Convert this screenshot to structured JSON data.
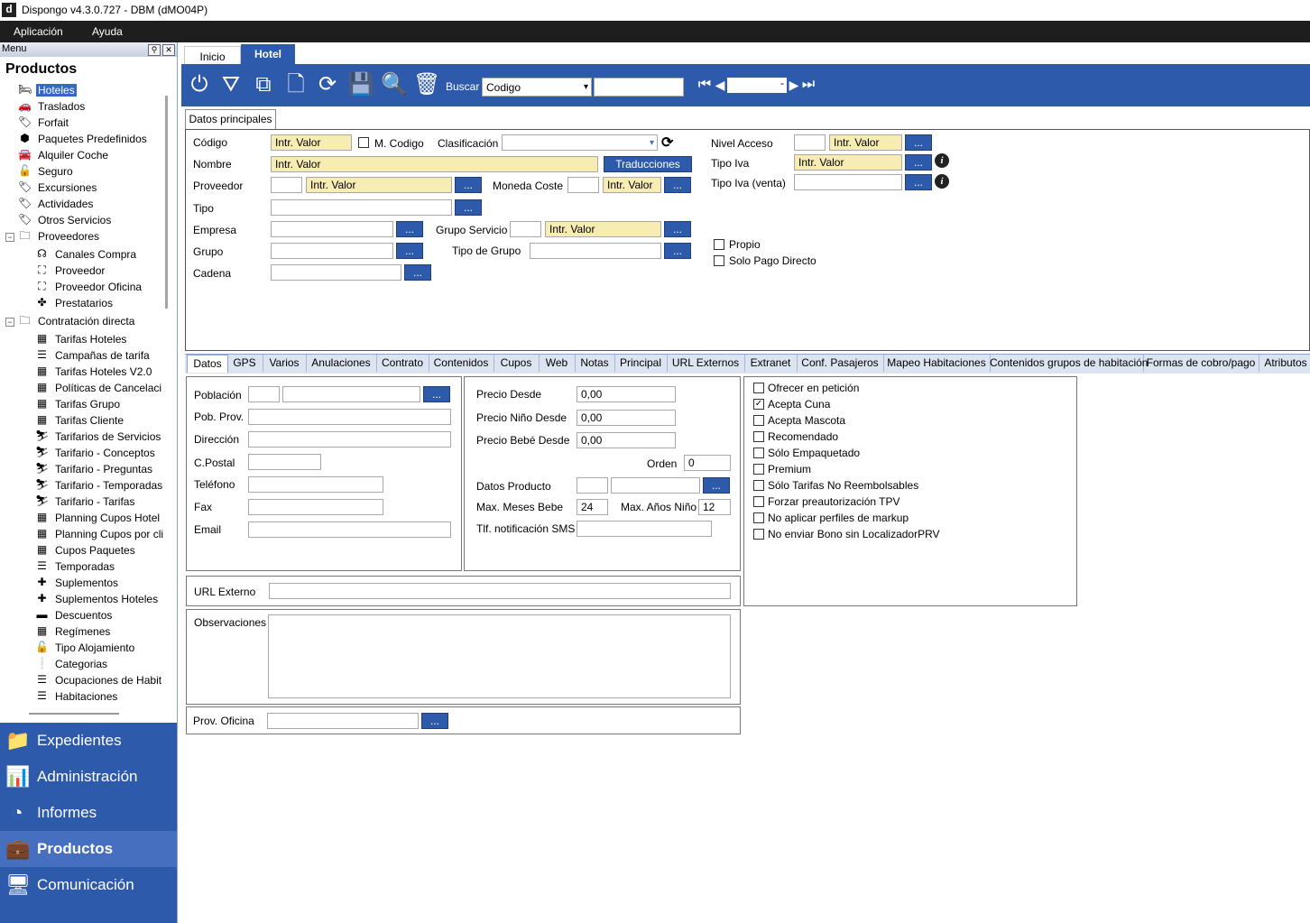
{
  "app": {
    "title": "Dispongo v4.3.0.727 - DBM (dMO04P)",
    "logo_letter": "d"
  },
  "menubar": {
    "items": [
      "Aplicación",
      "Ayuda"
    ]
  },
  "sidebar": {
    "menu_label": "Menu",
    "pin": "⚲",
    "close": "✕",
    "section_title": "Productos",
    "tree": [
      {
        "label": "Hoteles",
        "icon": "bed-icon",
        "glyph": "🛏",
        "level": 0,
        "selected": true
      },
      {
        "label": "Traslados",
        "icon": "car-icon",
        "glyph": "🚗",
        "level": 0
      },
      {
        "label": "Forfait",
        "icon": "tag-icon",
        "glyph": "🏷",
        "level": 0
      },
      {
        "label": "Paquetes Predefinidos",
        "icon": "cube-icon",
        "glyph": "⬢",
        "level": 0
      },
      {
        "label": "Alquiler Coche",
        "icon": "car-icon",
        "glyph": "🚘",
        "level": 0
      },
      {
        "label": "Seguro",
        "icon": "lock-icon",
        "glyph": "🔓",
        "level": 0
      },
      {
        "label": "Excursiones",
        "icon": "tag-icon",
        "glyph": "🏷",
        "level": 0
      },
      {
        "label": "Actividades",
        "icon": "tag-icon",
        "glyph": "🏷",
        "level": 0
      },
      {
        "label": "Otros Servicios",
        "icon": "tag-icon",
        "glyph": "🏷",
        "level": 0
      },
      {
        "label": "Proveedores",
        "icon": "folder-icon",
        "glyph": "🗀",
        "level": 0,
        "expander": "−"
      },
      {
        "label": "Canales Compra",
        "icon": "signal-icon",
        "glyph": "☊",
        "level": 1
      },
      {
        "label": "Proveedor",
        "icon": "sitemap-icon",
        "glyph": "⛶",
        "level": 1
      },
      {
        "label": "Proveedor Oficina",
        "icon": "sitemap-icon",
        "glyph": "⛶",
        "level": 1
      },
      {
        "label": "Prestatarios",
        "icon": "puzzle-icon",
        "glyph": "✤",
        "level": 1
      },
      {
        "label": "Contratación directa",
        "icon": "folder-icon",
        "glyph": "🗀",
        "level": 0,
        "expander": "−"
      },
      {
        "label": "Tarifas Hoteles",
        "icon": "calendar-icon",
        "glyph": "▦",
        "level": 1
      },
      {
        "label": "Campañas de tarifa",
        "icon": "list-icon",
        "glyph": "☰",
        "level": 1
      },
      {
        "label": "Tarifas Hoteles V2.0",
        "icon": "calendar-icon",
        "glyph": "▦",
        "level": 1
      },
      {
        "label": "Políticas de Cancelaci",
        "icon": "calendar-icon",
        "glyph": "▦",
        "level": 1
      },
      {
        "label": "Tarifas Grupo",
        "icon": "calendar-icon",
        "glyph": "▦",
        "level": 1
      },
      {
        "label": "Tarifas Cliente",
        "icon": "calendar-icon",
        "glyph": "▦",
        "level": 1
      },
      {
        "label": "Tarifarios de Servicios",
        "icon": "skier-icon",
        "glyph": "⛷",
        "level": 1
      },
      {
        "label": "Tarifario - Conceptos",
        "icon": "skier-icon",
        "glyph": "⛷",
        "level": 1
      },
      {
        "label": "Tarifario - Preguntas",
        "icon": "skier-icon",
        "glyph": "⛷",
        "level": 1
      },
      {
        "label": "Tarifario - Temporadas",
        "icon": "skier-icon",
        "glyph": "⛷",
        "level": 1
      },
      {
        "label": "Tarifario - Tarifas",
        "icon": "skier-icon",
        "glyph": "⛷",
        "level": 1
      },
      {
        "label": "Planning Cupos Hotel",
        "icon": "calendar-icon",
        "glyph": "▦",
        "level": 1
      },
      {
        "label": "Planning Cupos por cli",
        "icon": "calendar-icon",
        "glyph": "▦",
        "level": 1
      },
      {
        "label": "Cupos Paquetes",
        "icon": "calendar-icon",
        "glyph": "▦",
        "level": 1
      },
      {
        "label": "Temporadas",
        "icon": "list-icon",
        "glyph": "☰",
        "level": 1
      },
      {
        "label": "Suplementos",
        "icon": "plus-icon",
        "glyph": "✚",
        "level": 1
      },
      {
        "label": "Suplementos Hoteles",
        "icon": "plus-icon",
        "glyph": "✚",
        "level": 1
      },
      {
        "label": "Descuentos",
        "icon": "minus-icon",
        "glyph": "▬",
        "level": 1
      },
      {
        "label": "Regímenes",
        "icon": "calendar-icon",
        "glyph": "▦",
        "level": 1
      },
      {
        "label": "Tipo Alojamiento",
        "icon": "lock-icon",
        "glyph": "🔓",
        "level": 1
      },
      {
        "label": "Categorias",
        "icon": "exclamation-icon",
        "glyph": "❕",
        "level": 1
      },
      {
        "label": "Ocupaciones de Habit",
        "icon": "list-icon",
        "glyph": "☰",
        "level": 1
      },
      {
        "label": "Habitaciones",
        "icon": "list-icon",
        "glyph": "☰",
        "level": 1
      }
    ],
    "nav": [
      {
        "label": "Expedientes",
        "icon": "folder-icon",
        "glyph": "📁"
      },
      {
        "label": "Administración",
        "icon": "bar-chart-icon",
        "glyph": "📊"
      },
      {
        "label": "Informes",
        "icon": "pie-chart-icon",
        "glyph": "◔"
      },
      {
        "label": "Productos",
        "icon": "suitcase-icon",
        "glyph": "💼",
        "active": true
      },
      {
        "label": "Comunicación",
        "icon": "monitor-icon",
        "glyph": "🖥"
      }
    ]
  },
  "tabs": {
    "inicio": "Inicio",
    "hotel": "Hotel"
  },
  "toolbar": {
    "buscar_label": "Buscar",
    "search_field_value": "Codigo",
    "search_text": "",
    "nav_value": "",
    "dropdown_arrow": "▾",
    "icons": {
      "power": "⏻",
      "filter": "⛛",
      "copy": "⧉",
      "new": "🗋",
      "refresh": "⟳",
      "save": "💾",
      "search": "🔍",
      "delete": "🗑",
      "first": "⏮",
      "prev": "◀",
      "next": "▶",
      "last": "⏭",
      "minus": "-"
    }
  },
  "main_tab": "Datos principales",
  "form": {
    "codigo": "Código",
    "codigo_val": "Intr. Valor",
    "m_codigo": "M. Codigo",
    "clasificacion": "Clasificación",
    "nombre": "Nombre",
    "nombre_val": "Intr. Valor",
    "traducciones": "Traducciones",
    "proveedor": "Proveedor",
    "proveedor_val": "Intr. Valor",
    "moneda_coste": "Moneda Coste",
    "moneda_val": "Intr. Valor",
    "tipo": "Tipo",
    "empresa": "Empresa",
    "grupo_servicio": "Grupo Servicio",
    "grupo_servicio_val": "Intr. Valor",
    "grupo": "Grupo",
    "tipo_de_grupo": "Tipo de Grupo",
    "cadena": "Cadena",
    "nivel_acceso": "Nivel Acceso",
    "nivel_val": "Intr. Valor",
    "tipo_iva": "Tipo Iva",
    "tipo_iva_val": "Intr. Valor",
    "tipo_iva_venta": "Tipo Iva (venta)",
    "propio": "Propio",
    "solo_pago": "Solo Pago Directo",
    "ellipsis": "...",
    "info": "i",
    "refresh": "⟳"
  },
  "subtabs": [
    {
      "label": "Datos",
      "w": 44
    },
    {
      "label": "GPS",
      "w": 40
    },
    {
      "label": "Varios",
      "w": 48
    },
    {
      "label": "Anulaciones",
      "w": 78
    },
    {
      "label": "Contrato",
      "w": 58
    },
    {
      "label": "Contenidos",
      "w": 72
    },
    {
      "label": "Cupos",
      "w": 50
    },
    {
      "label": "Web",
      "w": 40
    },
    {
      "label": "Notas",
      "w": 44
    },
    {
      "label": "Principal",
      "w": 58
    },
    {
      "label": "URL Externos",
      "w": 86
    },
    {
      "label": "Extranet",
      "w": 58
    },
    {
      "label": "Conf. Pasajeros",
      "w": 96
    },
    {
      "label": "Mapeo Habitaciones",
      "w": 118
    },
    {
      "label": "Contenidos grupos de habitación",
      "w": 170
    },
    {
      "label": "Formas de cobro/pago",
      "w": 128
    },
    {
      "label": "Atributos",
      "w": 60
    }
  ],
  "datos": {
    "poblacion": "Población",
    "pob_prov": "Pob. Prov.",
    "direccion": "Dirección",
    "cpostal": "C.Postal",
    "telefono": "Teléfono",
    "fax": "Fax",
    "email": "Email",
    "precio_desde": "Precio Desde",
    "precio_desde_val": "0,00",
    "precio_nino": "Precio Niño Desde",
    "precio_nino_val": "0,00",
    "precio_bebe": "Precio Bebé Desde",
    "precio_bebe_val": "0,00",
    "orden": "Orden",
    "orden_val": "0",
    "datos_producto": "Datos Producto",
    "max_meses_bebe": "Max. Meses Bebe",
    "max_meses_val": "24",
    "max_anos_nino": "Max. Años Niño",
    "max_anos_val": "12",
    "tlf_sms": "Tlf. notificación SMS",
    "url_externo": "URL Externo",
    "observaciones": "Observaciones",
    "prov_oficina": "Prov. Oficina"
  },
  "checks": [
    {
      "label": "Ofrecer en petición",
      "checked": false
    },
    {
      "label": "Acepta Cuna",
      "checked": true
    },
    {
      "label": "Acepta Mascota",
      "checked": false
    },
    {
      "label": "Recomendado",
      "checked": false
    },
    {
      "label": "Sólo Empaquetado",
      "checked": false
    },
    {
      "label": "Premium",
      "checked": false
    },
    {
      "label": "Sólo Tarifas No Reembolsables",
      "checked": false
    },
    {
      "label": "Forzar preautorización TPV",
      "checked": false
    },
    {
      "label": "No aplicar perfiles de markup",
      "checked": false
    },
    {
      "label": "No enviar Bono sin LocalizadorPRV",
      "checked": false
    }
  ],
  "check_mark": "✓"
}
